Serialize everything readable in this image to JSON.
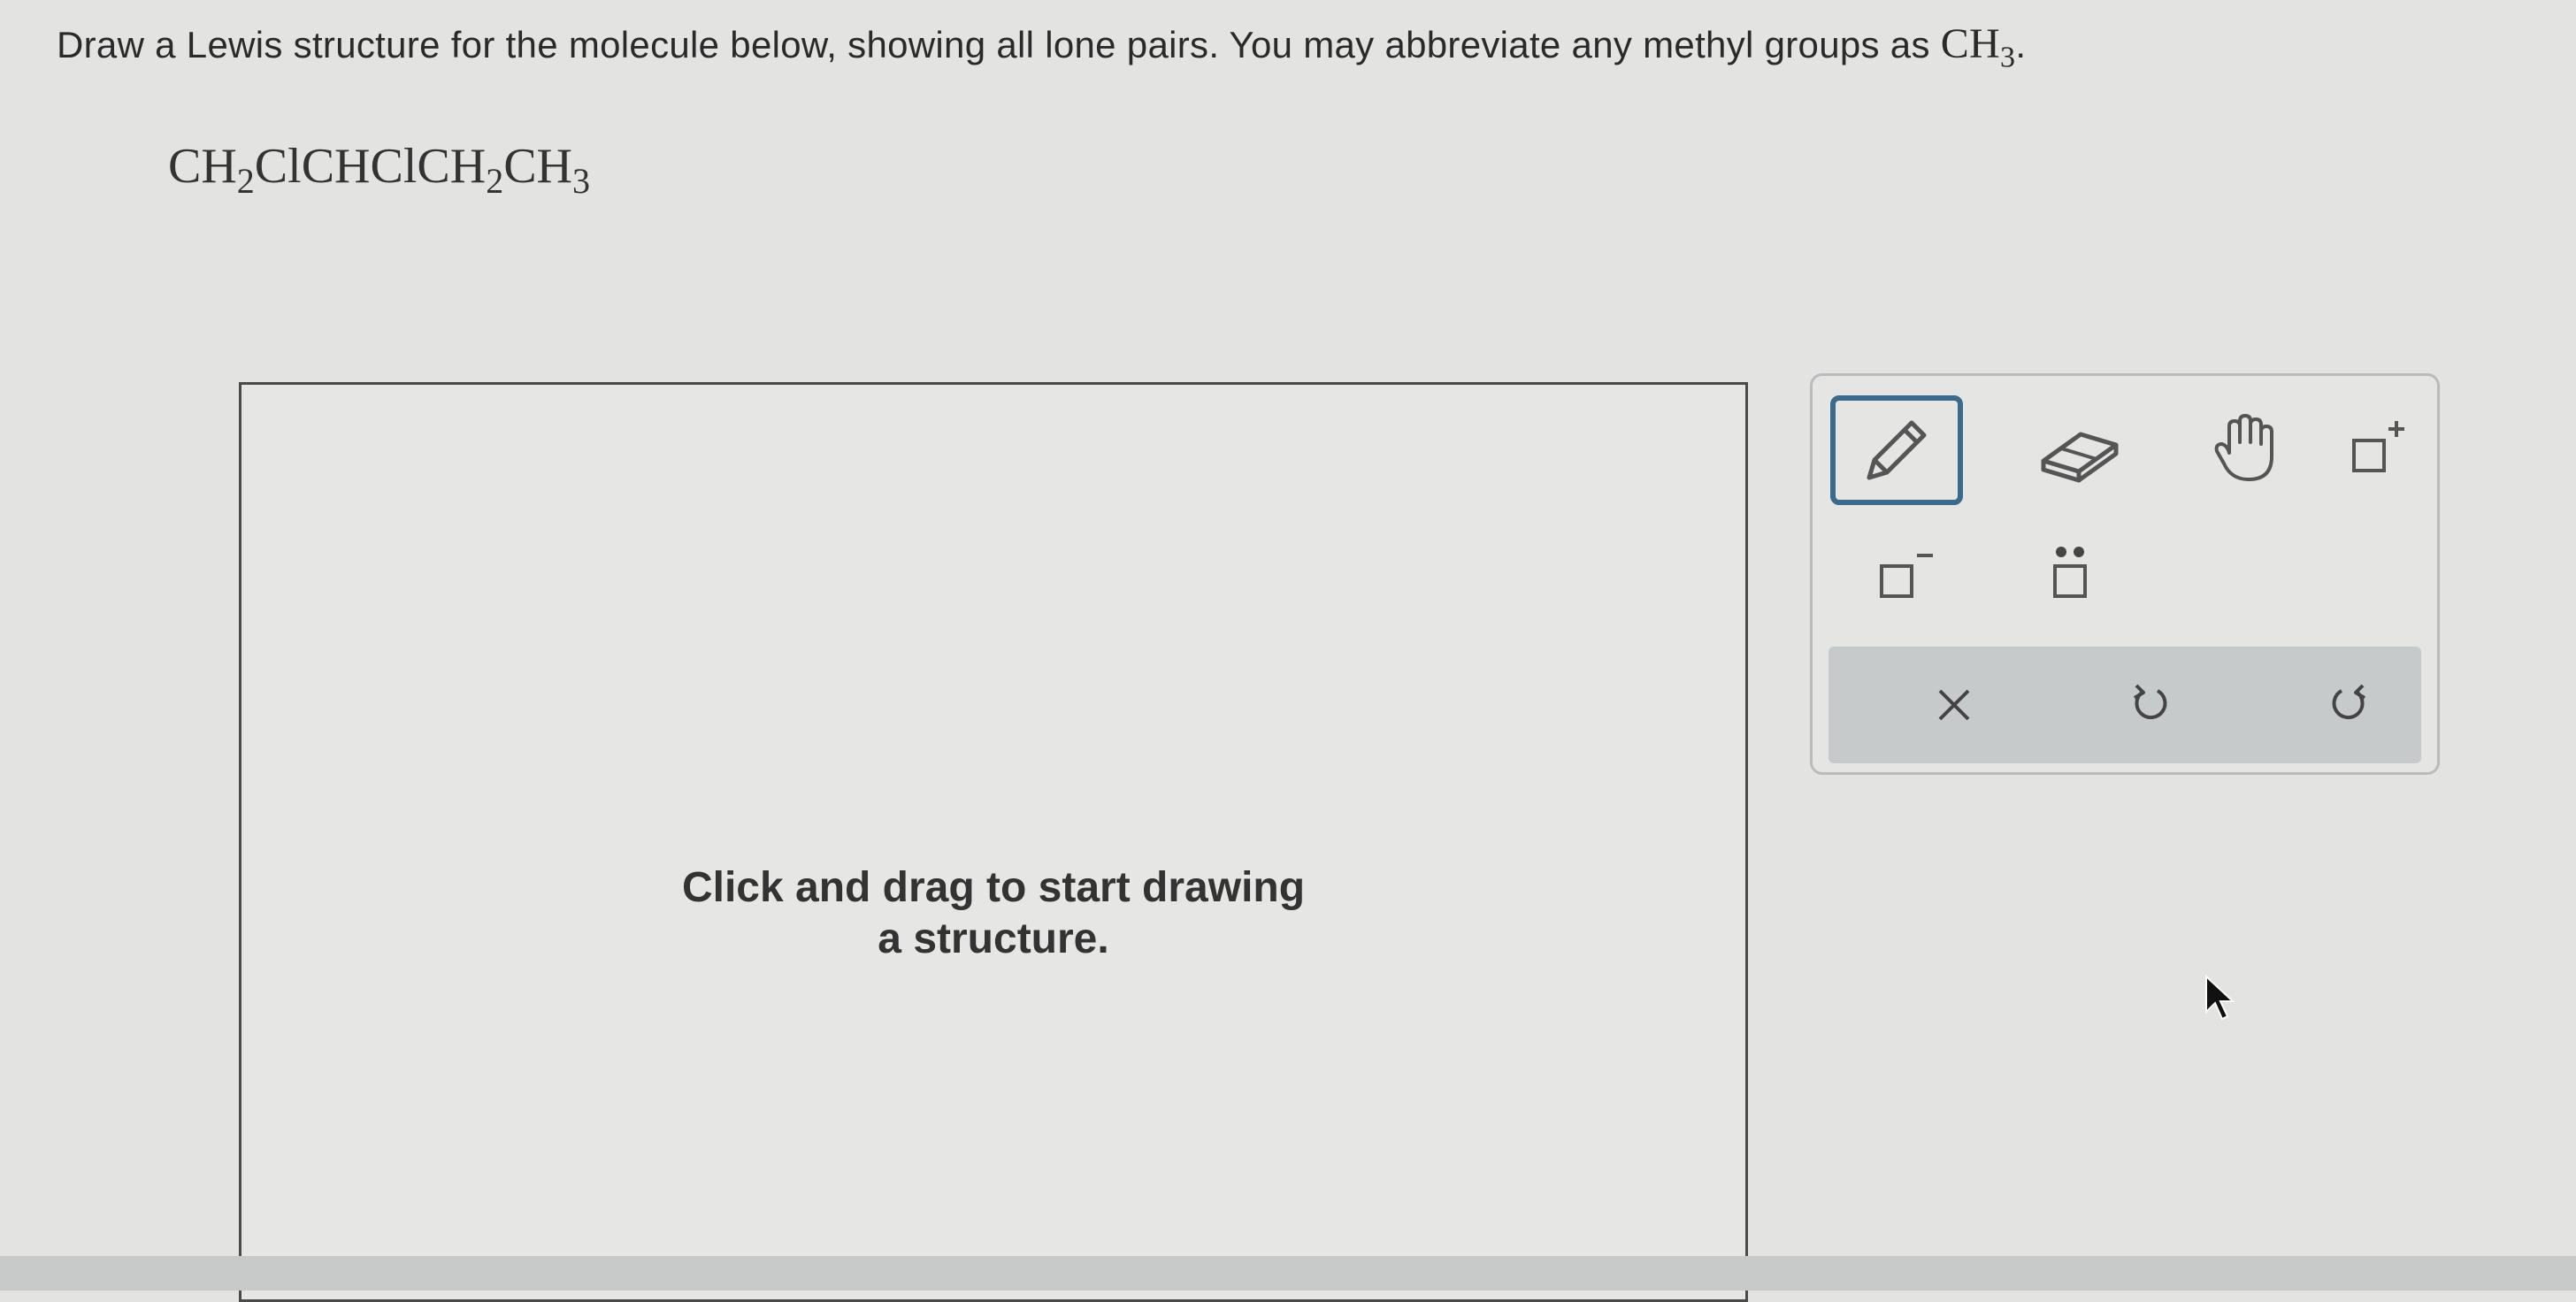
{
  "question": {
    "prefix": "Draw a Lewis structure for the molecule below, showing all lone pairs. You may abbreviate any methyl groups as ",
    "methyl_main": "CH",
    "methyl_sub": "3",
    "suffix": "."
  },
  "formula": {
    "parts": [
      {
        "text": "CH",
        "sub": "2"
      },
      {
        "text": "ClCHClCH",
        "sub": "2"
      },
      {
        "text": "CH",
        "sub": "3"
      }
    ]
  },
  "canvas": {
    "hint_line1": "Click and drag to start drawing",
    "hint_line2": "a structure."
  },
  "toolbar": {
    "tools": [
      {
        "name": "pencil-icon",
        "selected": true
      },
      {
        "name": "eraser-icon",
        "selected": false
      },
      {
        "name": "hand-icon",
        "selected": false
      },
      {
        "name": "positive-charge-icon",
        "selected": false
      },
      {
        "name": "negative-charge-icon",
        "selected": false
      },
      {
        "name": "lone-pair-icon",
        "selected": false
      }
    ],
    "actions": [
      {
        "name": "clear-icon"
      },
      {
        "name": "undo-icon"
      },
      {
        "name": "redo-icon"
      }
    ],
    "selected_color": "#3c6a8d"
  }
}
